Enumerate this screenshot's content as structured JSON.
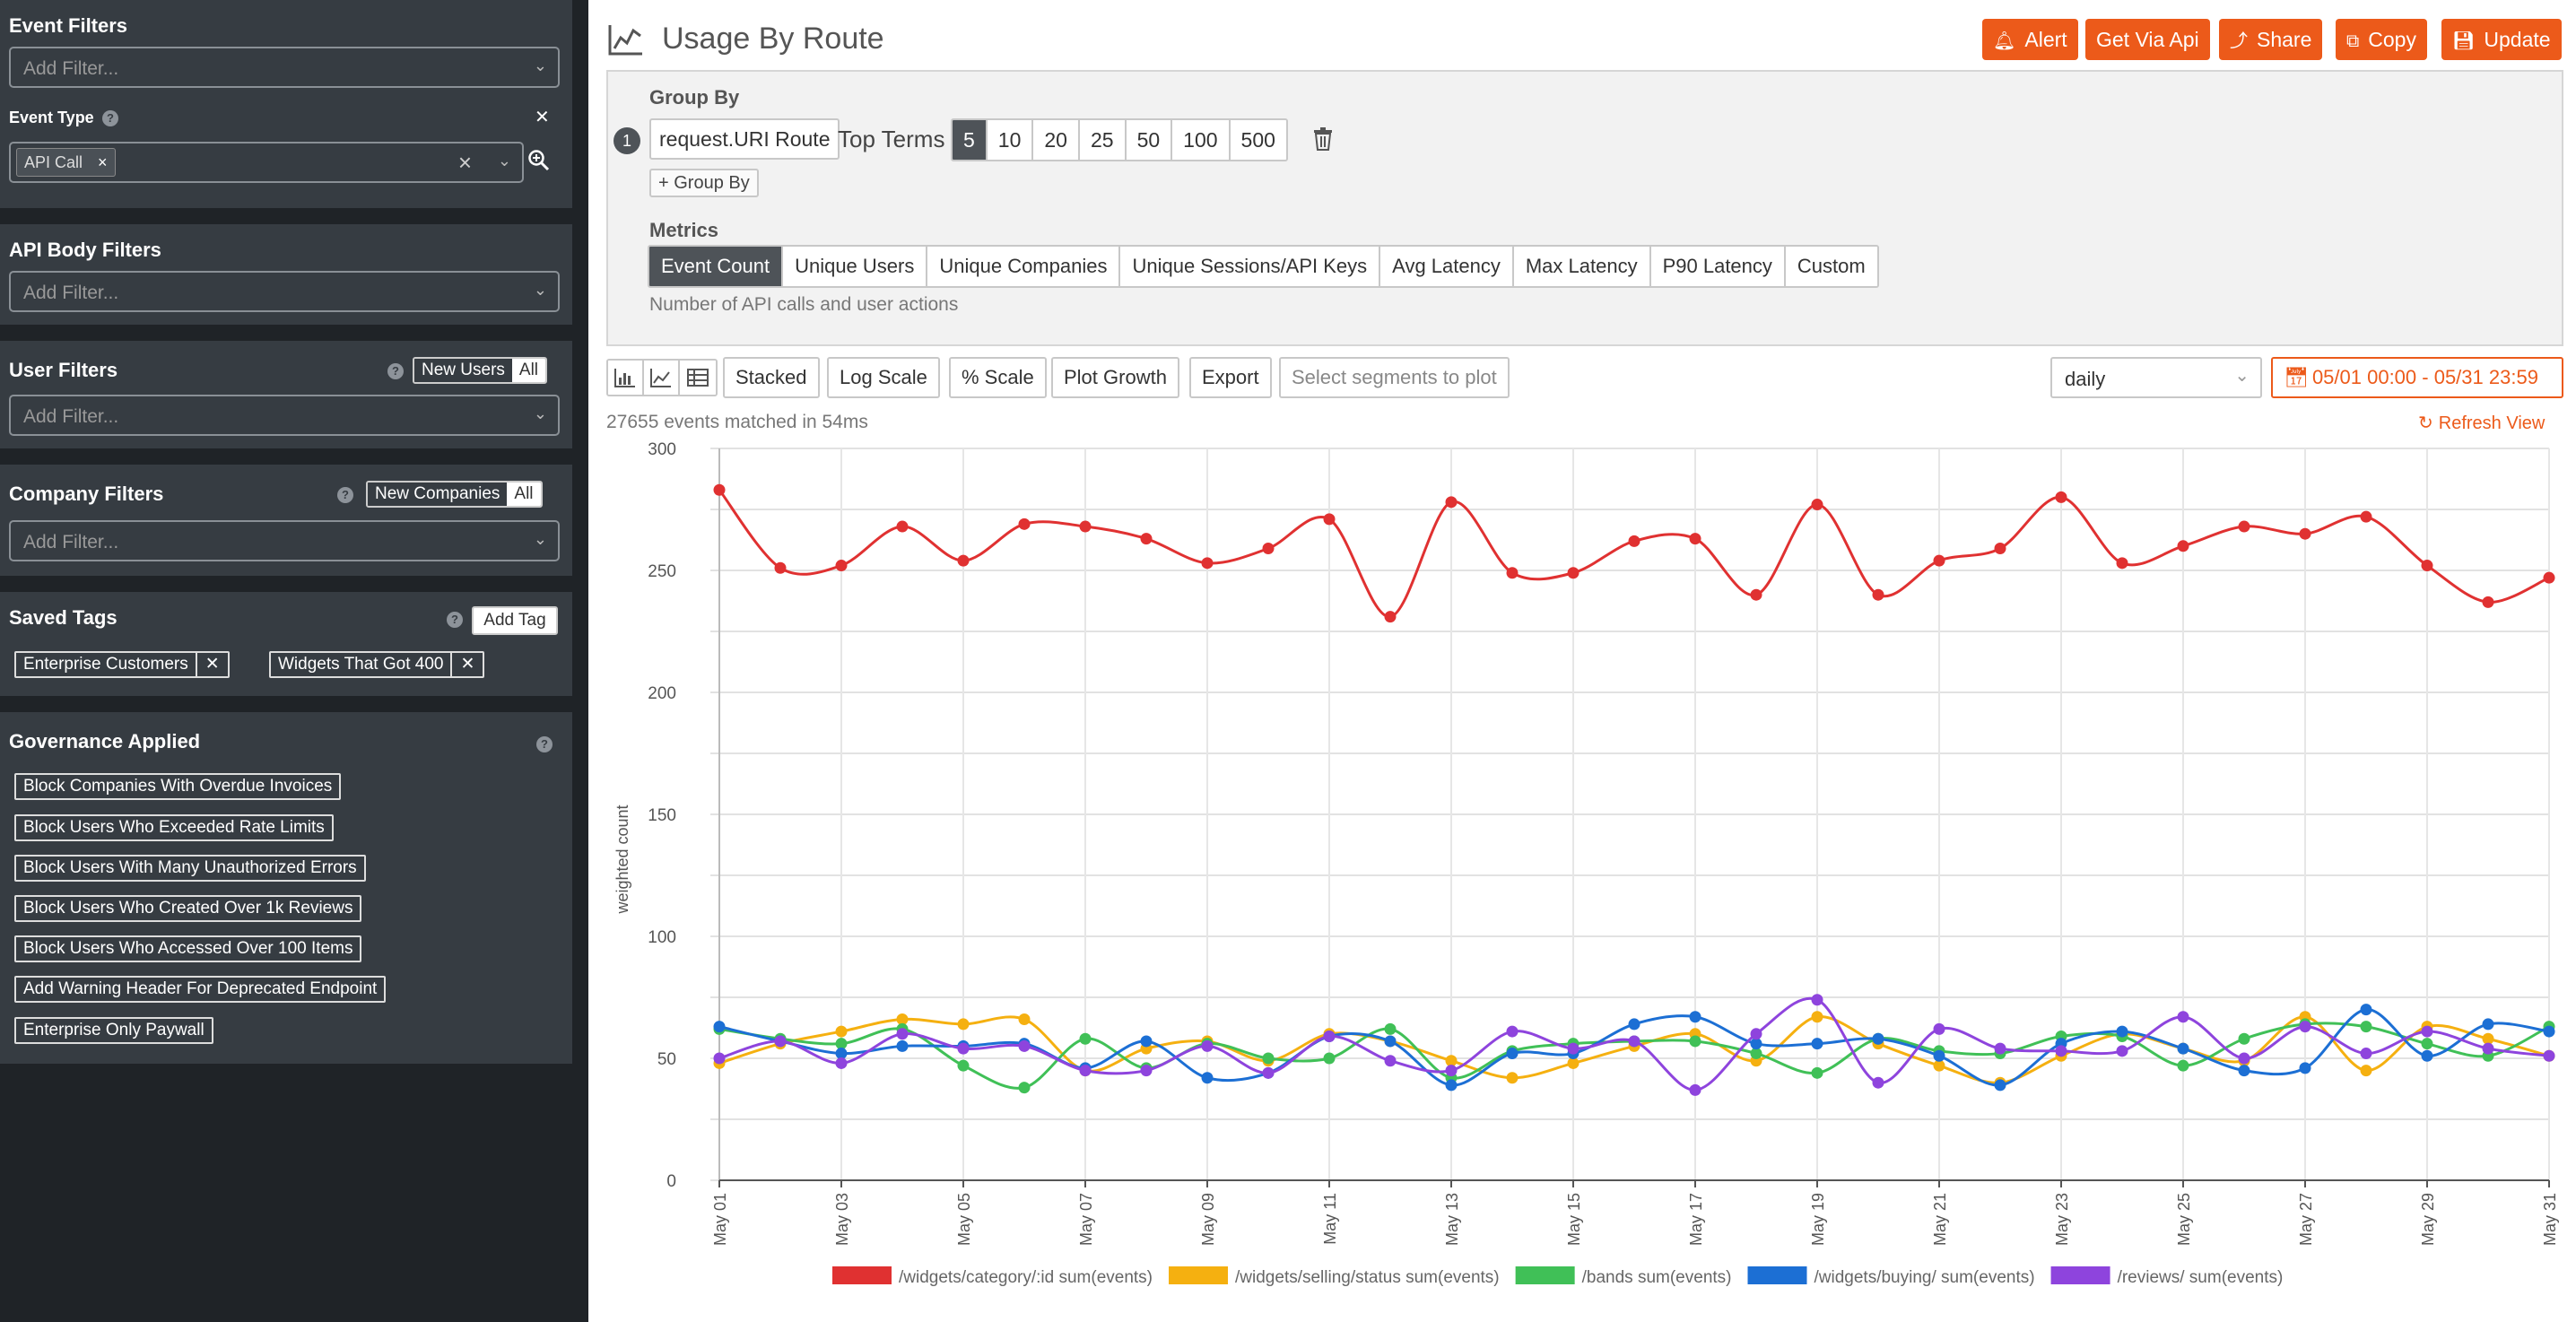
{
  "sidebar": {
    "event_filters": {
      "title": "Event Filters",
      "placeholder": "Add Filter..."
    },
    "event_type": {
      "label": "Event Type",
      "chip": "API Call",
      "chip_remove": "×",
      "clear": "✕"
    },
    "api_body": {
      "title": "API Body Filters",
      "placeholder": "Add Filter..."
    },
    "user_filters": {
      "title": "User Filters",
      "toggle": [
        "New Users",
        "All"
      ],
      "selected": "All",
      "placeholder": "Add Filter..."
    },
    "company_filters": {
      "title": "Company Filters",
      "toggle": [
        "New Companies",
        "All"
      ],
      "selected": "All",
      "placeholder": "Add Filter..."
    },
    "saved_tags": {
      "title": "Saved Tags",
      "add_label": "Add Tag",
      "tags": [
        "Enterprise Customers",
        "Widgets That Got 400"
      ],
      "remove": "✕"
    },
    "governance": {
      "title": "Governance Applied",
      "rules": [
        "Block Companies With Overdue Invoices",
        "Block Users Who Exceeded Rate Limits",
        "Block Users With Many Unauthorized Errors",
        "Block Users Who Created Over 1k Reviews",
        "Block Users Who Accessed Over 100 Items",
        "Add Warning Header For Deprecated Endpoint",
        "Enterprise Only Paywall"
      ]
    }
  },
  "header": {
    "title": "Usage By Route",
    "actions": [
      "Alert",
      "Get Via Api",
      "Share",
      "Copy",
      "Update"
    ]
  },
  "query": {
    "group_by_title": "Group By",
    "group_index": "1",
    "group_field": "request.URI Route",
    "top_terms_label": "Top Terms",
    "top_terms": [
      "5",
      "10",
      "20",
      "25",
      "50",
      "100",
      "500"
    ],
    "top_terms_selected": "5",
    "add_group_label": "+ Group By",
    "metrics_title": "Metrics",
    "metrics": [
      "Event Count",
      "Unique Users",
      "Unique Companies",
      "Unique Sessions/API Keys",
      "Avg Latency",
      "Max Latency",
      "P90 Latency",
      "Custom"
    ],
    "metric_selected": "Event Count",
    "metric_description": "Number of API calls and user actions"
  },
  "toolbar": {
    "buttons": [
      "Stacked",
      "Log Scale",
      "% Scale",
      "Plot Growth",
      "Export"
    ],
    "segments_placeholder": "Select segments to plot",
    "interval": "daily",
    "date_range": "05/01 00:00 - 05/31 23:59"
  },
  "status": {
    "matched": "27655 events matched in 54ms",
    "refresh": "Refresh View"
  },
  "colors": {
    "accent": "#ec5a1a",
    "sidebar_bg": "#1f2327",
    "panel_bg": "#363c42"
  },
  "icons": [
    "line-chart-icon",
    "bell-icon",
    "code-icon",
    "share-icon",
    "copy-icon",
    "save-icon",
    "trash-icon",
    "bar-chart-icon",
    "table-icon",
    "calendar-icon",
    "refresh-icon",
    "zoom-icon",
    "help-icon"
  ],
  "chart_data": {
    "type": "line",
    "ylabel": "weighted count",
    "ylim": [
      0,
      300
    ],
    "yticks": [
      0,
      50,
      100,
      150,
      200,
      250,
      300
    ],
    "x": [
      "May 01",
      "May 02",
      "May 03",
      "May 04",
      "May 05",
      "May 06",
      "May 07",
      "May 08",
      "May 09",
      "May 10",
      "May 11",
      "May 12",
      "May 13",
      "May 14",
      "May 15",
      "May 16",
      "May 17",
      "May 18",
      "May 19",
      "May 20",
      "May 21",
      "May 22",
      "May 23",
      "May 24",
      "May 25",
      "May 26",
      "May 27",
      "May 28",
      "May 29",
      "May 30",
      "May 31"
    ],
    "xticks": [
      "May 01",
      "May 03",
      "May 05",
      "May 07",
      "May 09",
      "May 11",
      "May 13",
      "May 15",
      "May 17",
      "May 19",
      "May 21",
      "May 23",
      "May 25",
      "May 27",
      "May 29",
      "May 31"
    ],
    "series": [
      {
        "name": "/widgets/category/:id  sum(events)",
        "color": "#e03131",
        "values": [
          283,
          251,
          252,
          268,
          254,
          269,
          268,
          263,
          253,
          259,
          271,
          231,
          278,
          249,
          249,
          262,
          263,
          240,
          277,
          240,
          254,
          259,
          280,
          253,
          260,
          268,
          265,
          272,
          252,
          237,
          247
        ]
      },
      {
        "name": "/widgets/selling/status  sum(events)",
        "color": "#f5b010",
        "values": [
          48,
          56,
          61,
          66,
          64,
          66,
          45,
          54,
          57,
          49,
          60,
          57,
          49,
          42,
          48,
          55,
          60,
          49,
          67,
          56,
          47,
          40,
          51,
          60,
          54,
          49,
          67,
          45,
          63,
          58,
          51
        ]
      },
      {
        "name": "/bands  sum(events)",
        "color": "#40c057",
        "values": [
          62,
          58,
          56,
          62,
          47,
          38,
          58,
          46,
          56,
          50,
          50,
          62,
          42,
          53,
          56,
          57,
          57,
          52,
          44,
          58,
          53,
          52,
          59,
          59,
          47,
          58,
          64,
          63,
          56,
          51,
          63
        ]
      },
      {
        "name": "/widgets/buying/  sum(events)",
        "color": "#1c6fd4",
        "values": [
          63,
          57,
          52,
          55,
          55,
          56,
          46,
          57,
          42,
          44,
          59,
          57,
          39,
          52,
          52,
          64,
          67,
          56,
          56,
          58,
          51,
          39,
          56,
          61,
          54,
          45,
          46,
          70,
          51,
          64,
          61
        ]
      },
      {
        "name": "/reviews/  sum(events)",
        "color": "#8e44dd",
        "values": [
          50,
          57,
          48,
          60,
          54,
          55,
          45,
          45,
          55,
          44,
          59,
          49,
          45,
          61,
          54,
          57,
          37,
          60,
          74,
          40,
          62,
          54,
          53,
          53,
          67,
          50,
          63,
          52,
          61,
          54,
          51
        ]
      }
    ]
  }
}
